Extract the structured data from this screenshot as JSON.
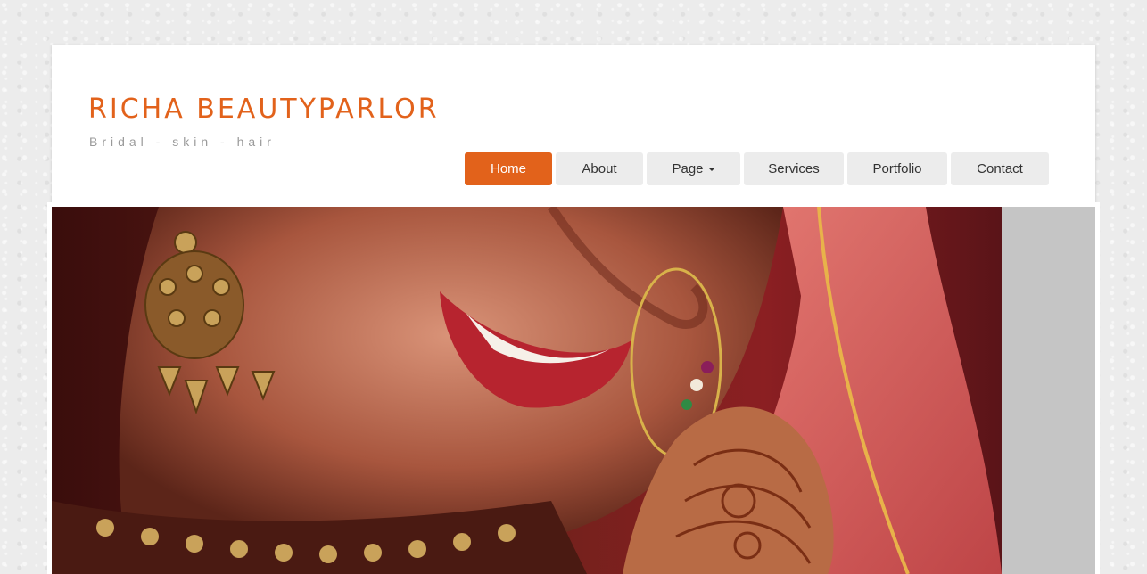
{
  "site": {
    "title": "RICHA BEAUTYPARLOR",
    "tagline": "Bridal - skin - hair"
  },
  "nav": {
    "items": [
      {
        "label": "Home",
        "active": true
      },
      {
        "label": "About",
        "active": false
      },
      {
        "label": "Page",
        "active": false,
        "has_dropdown": true
      },
      {
        "label": "Services",
        "active": false
      },
      {
        "label": "Portfolio",
        "active": false
      },
      {
        "label": "Contact",
        "active": false
      }
    ]
  },
  "hero": {
    "image_subject": "bride-closeup-photo"
  },
  "colors": {
    "accent": "#e2621b",
    "nav_bg": "#ececec",
    "tagline": "#9a9a9a",
    "page_bg": "#ececec"
  }
}
